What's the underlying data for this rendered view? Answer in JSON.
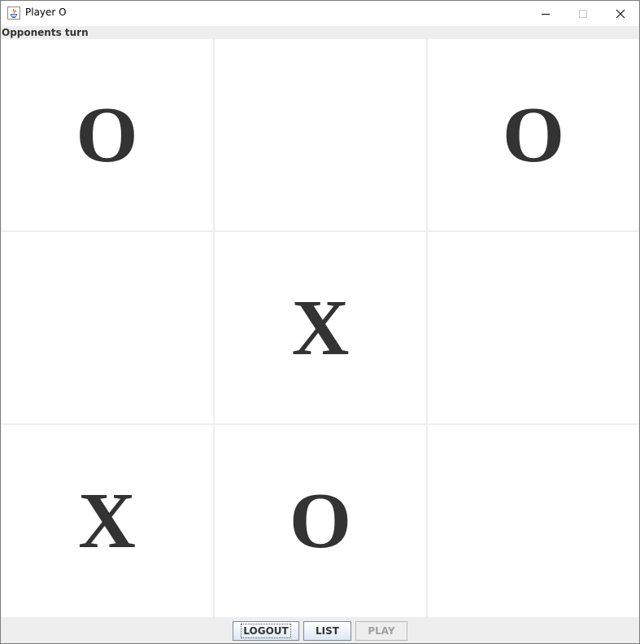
{
  "window": {
    "title": "Player O"
  },
  "status": {
    "text": "Opponents turn"
  },
  "board": {
    "cells": [
      "O",
      "",
      "O",
      "",
      "X",
      "",
      "X",
      "O",
      ""
    ]
  },
  "buttons": {
    "logout": "LOGOUT",
    "list": "LIST",
    "play": "PLAY"
  },
  "colors": {
    "mark": "#333333",
    "grid": "#eeeeee",
    "panel": "#eeeeee"
  }
}
